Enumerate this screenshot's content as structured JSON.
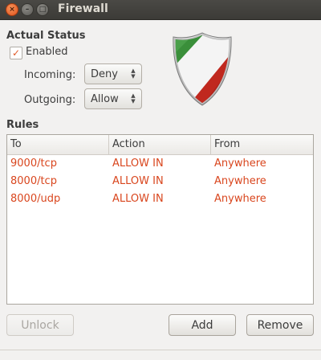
{
  "window": {
    "title": "Firewall",
    "close_glyph": "×",
    "minimize_glyph": "–",
    "maximize_glyph": "□"
  },
  "status": {
    "heading": "Actual Status",
    "enabled_label": "Enabled",
    "enabled_checked": true,
    "incoming_label": "Incoming:",
    "incoming_value": "Deny",
    "outgoing_label": "Outgoing:",
    "outgoing_value": "Allow"
  },
  "rules": {
    "heading": "Rules",
    "columns": [
      "To",
      "Action",
      "From"
    ],
    "rows": [
      {
        "to": "9000/tcp",
        "action": "ALLOW IN",
        "from": "Anywhere"
      },
      {
        "to": "8000/tcp",
        "action": "ALLOW IN",
        "from": "Anywhere"
      },
      {
        "to": "8000/udp",
        "action": "ALLOW IN",
        "from": "Anywhere"
      }
    ]
  },
  "buttons": {
    "unlock": "Unlock",
    "add": "Add",
    "remove": "Remove"
  },
  "colors": {
    "rule_text": "#d9461e",
    "shield_green": "#3a8f3a",
    "shield_red": "#c0281e",
    "checkbox_accent": "#e05a28"
  },
  "icons": {
    "app_logo": "shield-icon",
    "combo_arrow": "up-down-arrows-icon",
    "check": "checkmark-icon"
  }
}
